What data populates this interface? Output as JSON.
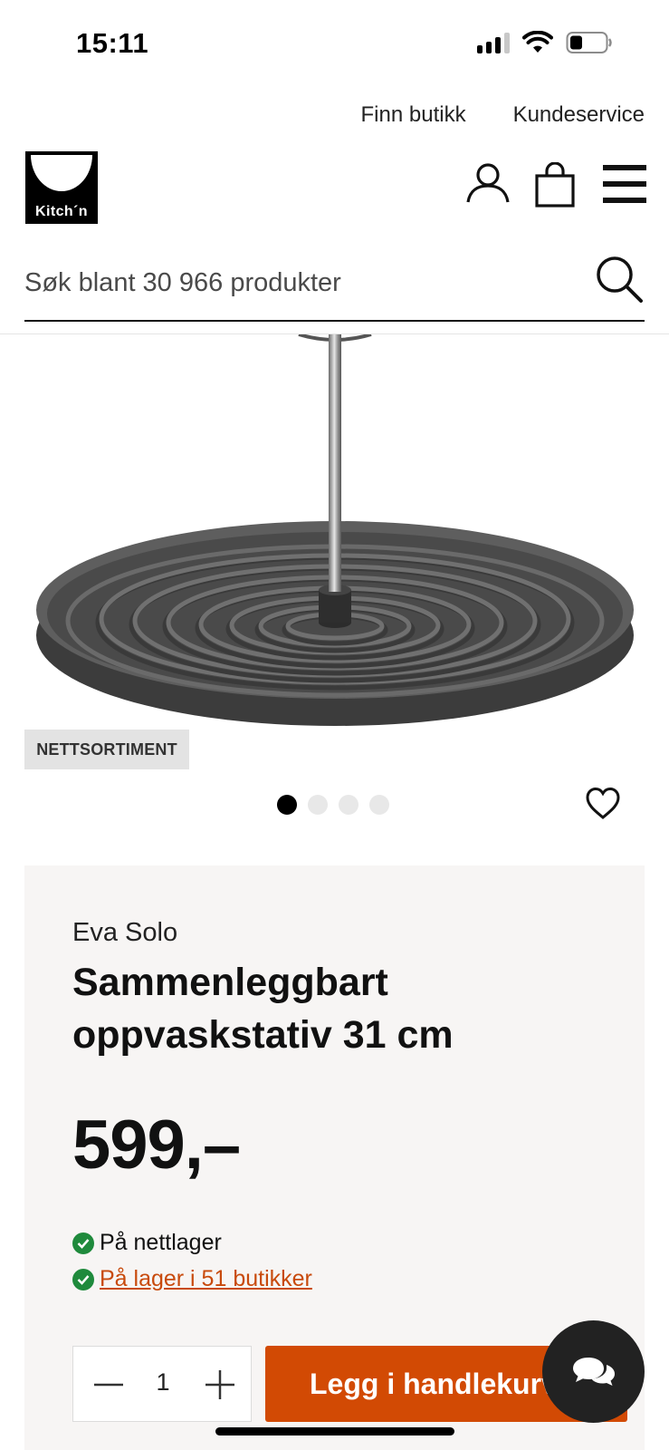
{
  "status_bar": {
    "time": "15:11"
  },
  "top_links": {
    "find_store": "Finn butikk",
    "customer_service": "Kundeservice"
  },
  "header": {
    "logo_text": "Kitch´n"
  },
  "search": {
    "placeholder": "Søk blant 30 966 produkter"
  },
  "product": {
    "badge": "NETTSORTIMENT",
    "carousel": {
      "total": 4,
      "active_index": 0
    },
    "brand": "Eva Solo",
    "title": "Sammenleggbart oppvaskstativ 31 cm",
    "price": "599,–",
    "stock": {
      "online": "På nettlager",
      "stores_link": "På lager i 51 butikker"
    },
    "quantity": "1",
    "add_to_cart": "Legg i handlekurv"
  },
  "colors": {
    "accent": "#d24a04",
    "link": "#c84a0c",
    "in_stock": "#1f8a3c",
    "card_bg": "#f7f5f4",
    "badge_bg": "#e3e3e3"
  },
  "icons": [
    "cellular-signal-icon",
    "wifi-icon",
    "battery-icon",
    "user-icon",
    "shopping-bag-icon",
    "menu-icon",
    "search-icon",
    "heart-icon",
    "check-circle-icon",
    "minus-icon",
    "plus-icon",
    "chat-icon"
  ]
}
